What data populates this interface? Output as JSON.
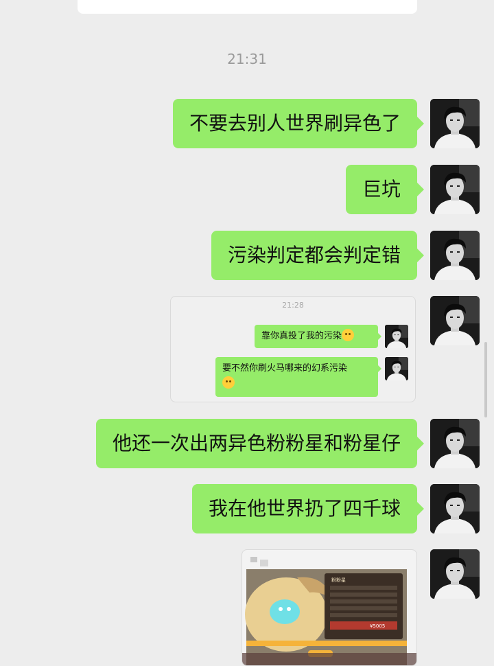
{
  "timestamp": "21:31",
  "messages": [
    {
      "text": "不要去别人世界刷异色了"
    },
    {
      "text": "巨坑"
    },
    {
      "text": "污染判定都会判定错"
    },
    {
      "text": "他还一次出两异色粉粉星和粉星仔"
    },
    {
      "text": "我在他世界扔了四千球"
    }
  ],
  "forwarded": {
    "time": "21:28",
    "messages": [
      {
        "text": "靠你真投了我的污染"
      },
      {
        "text": "要不然你刷火马哪来的幻系污染"
      }
    ]
  },
  "game_screenshot": {
    "title": "粉粉星",
    "price": "¥5005"
  },
  "icons": {
    "avatar": "person-portrait-avatar",
    "emoji": "laughing-emoji"
  },
  "colors": {
    "background": "#ededed",
    "bubble": "#95ec69"
  }
}
